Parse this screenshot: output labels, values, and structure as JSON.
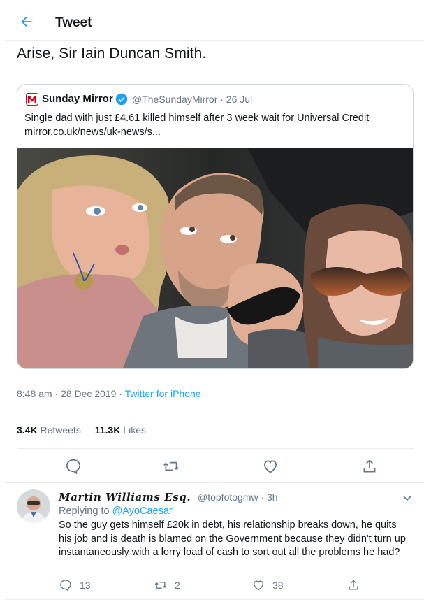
{
  "header": {
    "title": "Tweet",
    "back_icon": "back-arrow-icon"
  },
  "tweet": {
    "text": "Arise, Sir Iain Duncan Smith.",
    "timestamp": "8:48 am · 28 Dec 2019 · ",
    "source": "Twitter for iPhone",
    "retweets_count": "3.4K",
    "retweets_label": " Retweets",
    "likes_count": "11.3K",
    "likes_label": " Likes"
  },
  "quote": {
    "name": "Sunday Mirror",
    "meta": "@TheSundayMirror · 26 Jul",
    "text": "Single dad with just £4.61 killed himself after 3 week wait for Universal Credit",
    "link": "mirror.co.uk/news/uk-news/s..."
  },
  "actions": [
    "reply-icon",
    "retweet-icon",
    "like-icon",
    "share-icon"
  ],
  "reply": {
    "name": "Martin Williams Esq.",
    "handle": "@topfotogmw · 3h",
    "replying_prefix": "Replying to ",
    "replying_to": "@AyoCaesar",
    "text": "So the guy gets himself £20k in debt, his relationship breaks down, he quits his job and is death is blamed on the Government because they didn't turn up instantaneously with a lorry load of cash to sort out all the problems he had?",
    "reply_count": "13",
    "retweet_count": "2",
    "like_count": "38"
  },
  "colors": {
    "accent": "#1da1f2",
    "muted": "#657786",
    "text": "#14171a",
    "border": "#e6ecf0"
  }
}
